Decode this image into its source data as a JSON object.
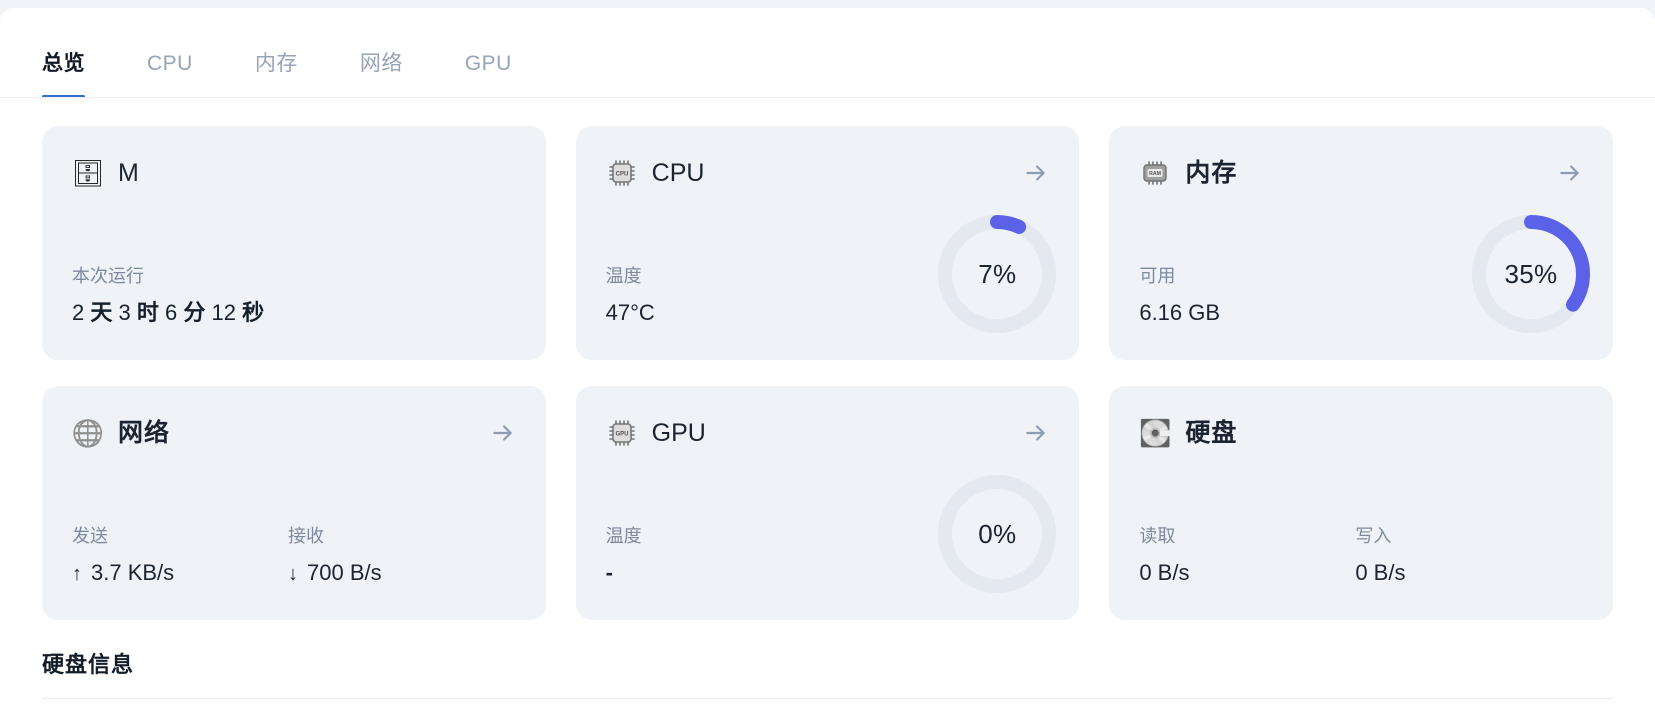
{
  "theme": {
    "accent_blue": "#2f6fd0",
    "donut_fill": "#5b62e8",
    "donut_track": "#e4e8ef",
    "card_bg": "#eff2f7",
    "page_bg": "#f1f3f8",
    "muted_text": "#7d8a9e"
  },
  "tabs": [
    {
      "label": "总览",
      "active": true
    },
    {
      "label": "CPU",
      "active": false
    },
    {
      "label": "内存",
      "active": false
    },
    {
      "label": "网络",
      "active": false
    },
    {
      "label": "GPU",
      "active": false
    }
  ],
  "cards": {
    "uptime": {
      "icon": "server-rack-icon",
      "emoji": "🗄",
      "title": "M",
      "stat_label": "本次运行",
      "value_parts": [
        "2",
        "天",
        "3",
        "时",
        "6",
        "分",
        "12",
        "秒"
      ],
      "value_text": "2 天 3 时 6 分 12 秒",
      "has_arrow": false
    },
    "cpu": {
      "icon": "cpu-chip-icon",
      "emoji": "🖳",
      "title": "CPU",
      "stat_label": "温度",
      "stat_value": "47°C",
      "percent": 7,
      "percent_text": "7%",
      "has_arrow": true,
      "arrow_icon": "arrow-right-icon"
    },
    "memory": {
      "icon": "ram-chip-icon",
      "emoji": "🖭",
      "title": "内存",
      "stat_label": "可用",
      "stat_value": "6.16 GB",
      "percent": 35,
      "percent_text": "35%",
      "has_arrow": true,
      "arrow_icon": "arrow-right-icon"
    },
    "network": {
      "icon": "globe-icon",
      "emoji": "🌐",
      "title": "网络",
      "upload_label": "发送",
      "upload_glyph": "↑",
      "upload_value": "3.7 KB/s",
      "download_label": "接收",
      "download_glyph": "↓",
      "download_value": "700 B/s",
      "has_arrow": true,
      "arrow_icon": "arrow-right-icon"
    },
    "gpu": {
      "icon": "gpu-chip-icon",
      "emoji": "🖵",
      "title": "GPU",
      "stat_label": "温度",
      "stat_value": "-",
      "percent": 0,
      "percent_text": "0%",
      "has_arrow": true,
      "arrow_icon": "arrow-right-icon"
    },
    "disk": {
      "icon": "hard-disk-icon",
      "emoji": "💽",
      "title": "硬盘",
      "read_label": "读取",
      "read_value": "0 B/s",
      "write_label": "写入",
      "write_value": "0 B/s",
      "has_arrow": false
    }
  },
  "disk_section": {
    "title": "硬盘信息"
  }
}
